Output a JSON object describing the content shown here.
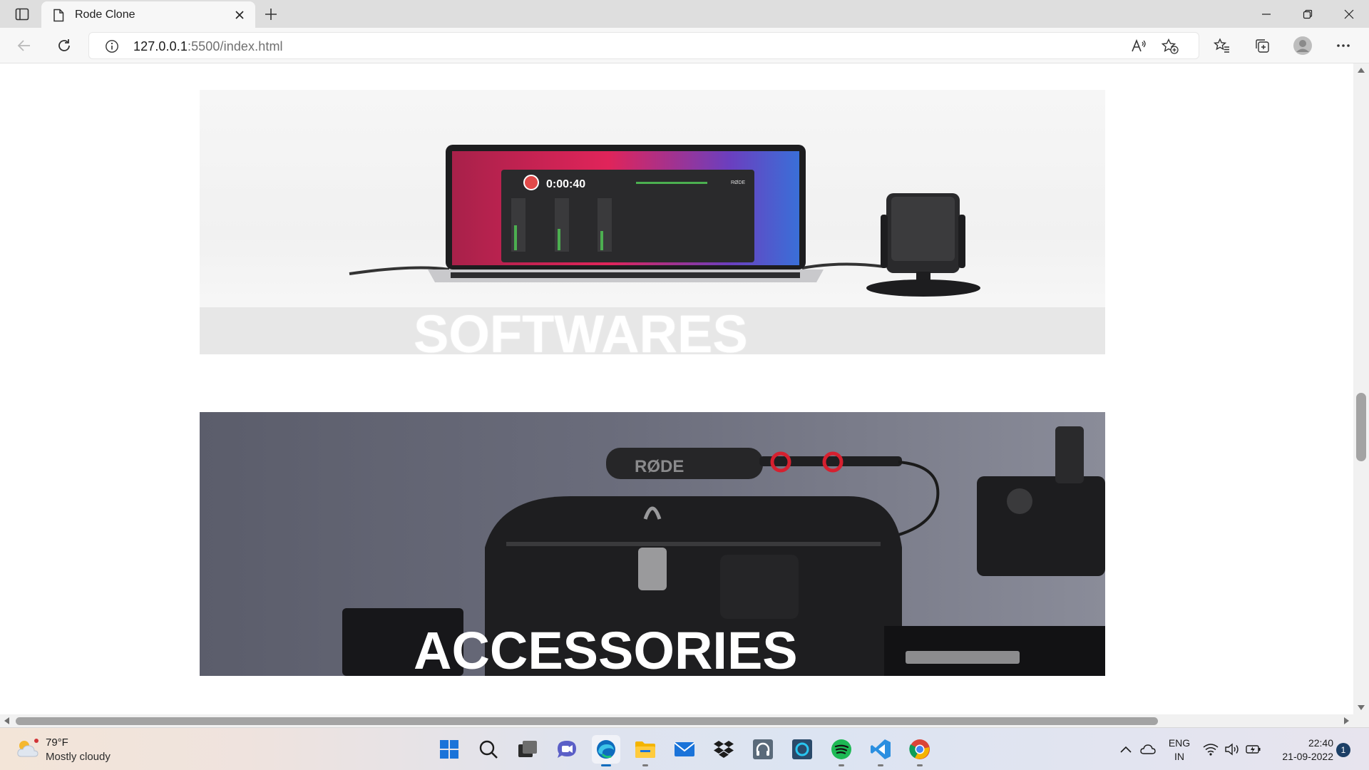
{
  "browser": {
    "tab": {
      "title": "Rode Clone"
    },
    "address": {
      "host": "127.0.0.1",
      "rest": ":5500/index.html"
    }
  },
  "page": {
    "cards": [
      {
        "title": "SOFTWARES"
      },
      {
        "title": "ACCESSORIES"
      }
    ],
    "laptop_screen": {
      "timer": "0:00:40",
      "brand": "RØDE"
    },
    "accessories_image": {
      "brand": "RØDE"
    }
  },
  "taskbar": {
    "weather": {
      "temp": "79°F",
      "desc": "Mostly cloudy"
    },
    "language": {
      "line1": "ENG",
      "line2": "IN"
    },
    "clock": {
      "time": "22:40",
      "date": "21-09-2022"
    },
    "notification_count": "1"
  },
  "colors": {
    "tab_strip": "#dedede",
    "toolbar": "#f7f7f7",
    "edge_blue": "#0f6cbd",
    "spotify_green": "#1db954",
    "vscode_blue": "#2b8fe0"
  }
}
